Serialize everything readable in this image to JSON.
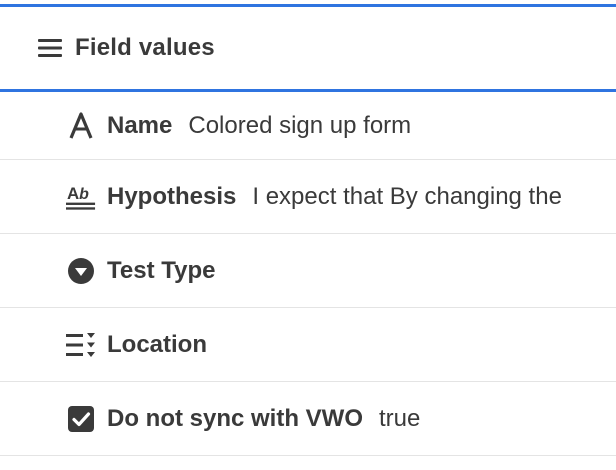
{
  "header": {
    "title": "Field values",
    "icon": "hamburger-menu-icon"
  },
  "colors": {
    "accent_rule": "#2f74e0",
    "text": "#3a3a3a",
    "divider": "#e4e4e4"
  },
  "fields": [
    {
      "icon": "text-a-icon",
      "name": "Name",
      "value": "Colored sign up form"
    },
    {
      "icon": "rich-text-ab-icon",
      "name": "Hypothesis",
      "value": "I expect that By changing the"
    },
    {
      "icon": "dropdown-circle-icon",
      "name": "Test Type",
      "value": ""
    },
    {
      "icon": "multi-select-list-icon",
      "name": "Location",
      "value": ""
    },
    {
      "icon": "checkbox-checked-icon",
      "name": "Do not sync with VWO",
      "value": "true"
    }
  ]
}
